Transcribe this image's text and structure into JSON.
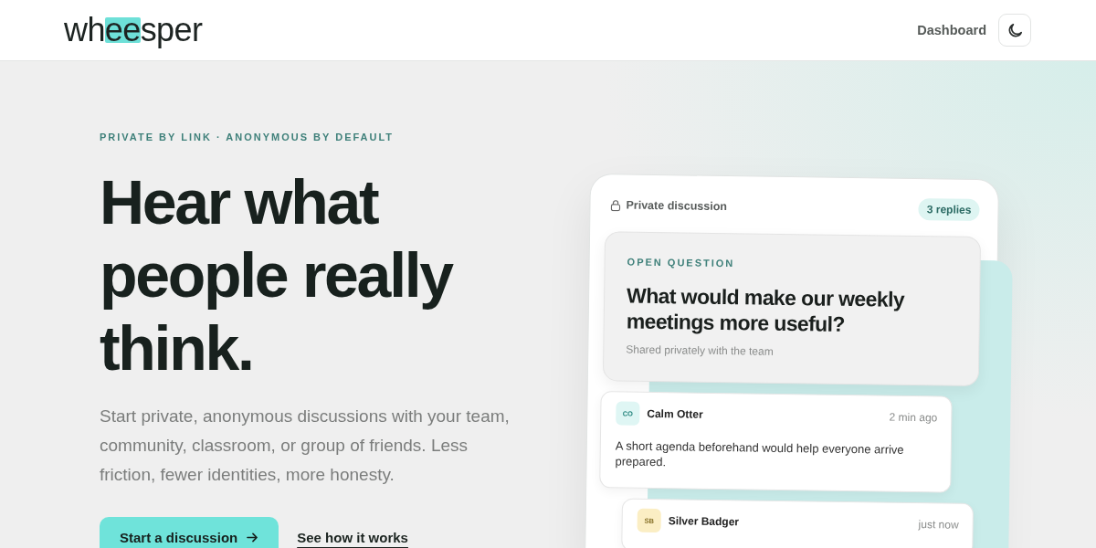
{
  "header": {
    "logo": [
      {
        "text": "wh",
        "highlighted": false
      },
      {
        "text": "ee",
        "highlighted": true
      },
      {
        "text": "sper",
        "highlighted": false
      }
    ],
    "nav_link": "Dashboard"
  },
  "hero": {
    "eyebrow": "PRIVATE BY LINK · ANONYMOUS BY DEFAULT",
    "headline": "Hear what people really think.",
    "description": "Start private, anonymous discussions with your team, community, classroom, or group of friends. Less friction, fewer identities, more honesty.",
    "primary_button": "Start a discussion",
    "secondary_link": "See how it works"
  },
  "preview": {
    "title": "Private discussion",
    "reply_count": "3 replies",
    "question": {
      "label": "OPEN QUESTION",
      "text": "What would make our weekly meetings more useful?",
      "note": "Shared privately with the team"
    },
    "replies": [
      {
        "initials": "CO",
        "color": "#dff6f4",
        "author": "Calm Otter",
        "time": "2 min ago",
        "text": "A short agenda beforehand would help everyone arrive prepared.",
        "children": [
          {
            "initials": "SB",
            "color": "#fbeec4",
            "author": "Silver Badger",
            "time": "just now"
          }
        ]
      }
    ]
  }
}
